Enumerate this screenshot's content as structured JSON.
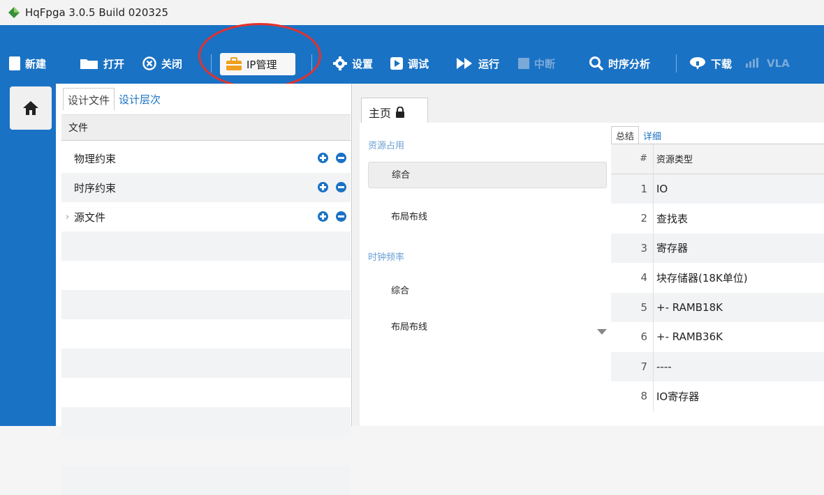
{
  "window": {
    "title": "HqFpga 3.0.5 Build 020325"
  },
  "toolbar": {
    "new": "新建",
    "open": "打开",
    "close": "关闭",
    "ip_manage": "IP管理",
    "settings": "设置",
    "debug": "调试",
    "run": "运行",
    "interrupt": "中断",
    "timing_analysis": "时序分析",
    "download": "下载",
    "vla": "VLA"
  },
  "left_panel": {
    "tabs": [
      "设计文件",
      "设计层次"
    ],
    "header": "文件",
    "items": [
      {
        "label": "物理约束"
      },
      {
        "label": "时序约束"
      },
      {
        "label": "源文件"
      }
    ]
  },
  "main": {
    "tab_label": "主页",
    "nav": {
      "resource_title": "资源占用",
      "resource_items": [
        "综合",
        "布局布线"
      ],
      "clock_title": "时钟频率",
      "clock_items": [
        "综合",
        "布局布线"
      ]
    },
    "sub_tabs": [
      "总结",
      "详细"
    ],
    "table": {
      "headers": [
        "#",
        "资源类型"
      ],
      "rows": [
        {
          "n": "1",
          "type": "IO"
        },
        {
          "n": "2",
          "type": "查找表"
        },
        {
          "n": "3",
          "type": "寄存器"
        },
        {
          "n": "4",
          "type": "块存储器(18K单位)"
        },
        {
          "n": "5",
          "type": "+- RAMB18K"
        },
        {
          "n": "6",
          "type": "+- RAMB36K"
        },
        {
          "n": "7",
          "type": "----"
        },
        {
          "n": "8",
          "type": "IO寄存器"
        }
      ]
    }
  },
  "colors": {
    "accent": "#1a72c4",
    "highlight": "#e8302a"
  }
}
